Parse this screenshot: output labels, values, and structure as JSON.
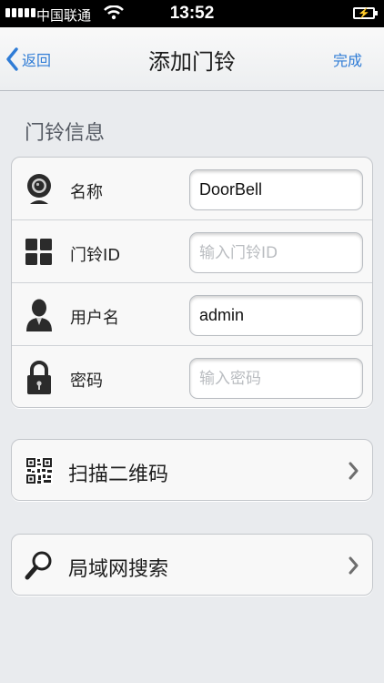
{
  "status_bar": {
    "carrier": "中国联通",
    "time": "13:52"
  },
  "nav": {
    "back_label": "返回",
    "title": "添加门铃",
    "done_label": "完成"
  },
  "section": {
    "title": "门铃信息"
  },
  "form": {
    "name": {
      "label": "名称",
      "value": "DoorBell",
      "icon": "camera-icon"
    },
    "doorbell_id": {
      "label": "门铃ID",
      "value": "",
      "placeholder": "输入门铃ID",
      "icon": "grid-icon"
    },
    "username": {
      "label": "用户名",
      "value": "admin",
      "icon": "user-icon"
    },
    "password": {
      "label": "密码",
      "value": "",
      "placeholder": "输入密码",
      "icon": "lock-icon"
    }
  },
  "actions": {
    "scan_qr": {
      "label": "扫描二维码",
      "icon": "qr-code-icon"
    },
    "lan_search": {
      "label": "局域网搜索",
      "icon": "magnifier-icon"
    }
  },
  "colors": {
    "accent": "#2f7cd6",
    "background": "#e9ebee"
  }
}
